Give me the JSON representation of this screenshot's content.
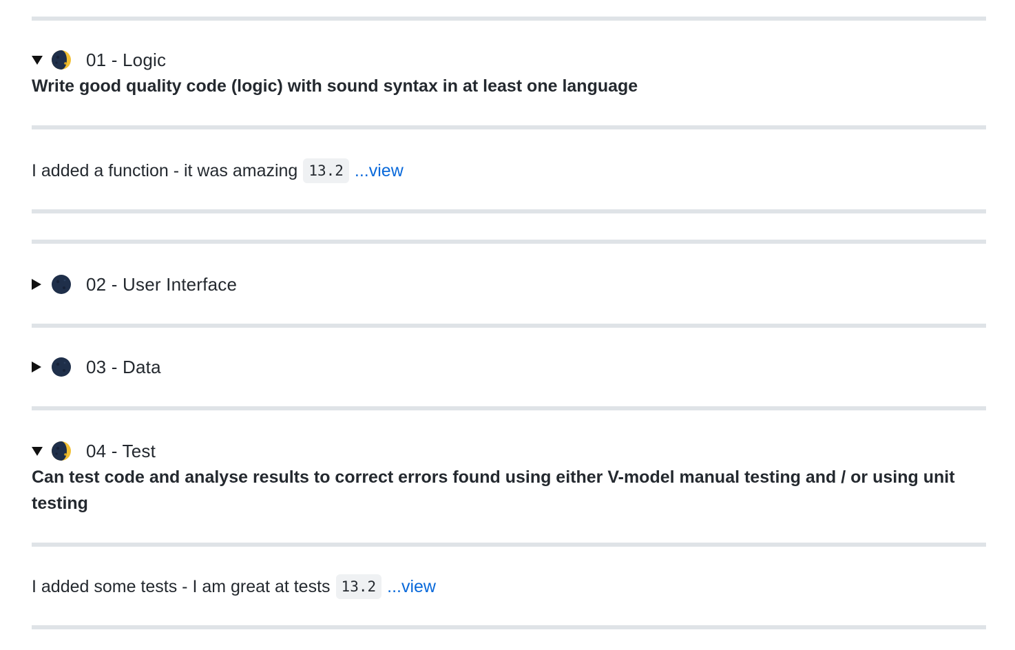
{
  "sections": [
    {
      "summary": "01 - Logic",
      "expanded": true,
      "moon_icon": "first-quarter-moon-icon",
      "description": "Write good quality code (logic) with sound syntax in at least one language",
      "entry_text": "I added a function - it was amazing",
      "entry_version": "13.2",
      "entry_link": "...view"
    },
    {
      "summary": "02 - User Interface",
      "expanded": false,
      "moon_icon": "new-moon-icon"
    },
    {
      "summary": "03 - Data",
      "expanded": false,
      "moon_icon": "new-moon-icon"
    },
    {
      "summary": "04 - Test",
      "expanded": true,
      "moon_icon": "first-quarter-moon-icon",
      "description": "Can test code and analyse results to correct errors found using either V-model manual testing and / or using unit testing",
      "entry_text": "I added some tests - I am great at tests",
      "entry_version": "13.2",
      "entry_link": "...view"
    }
  ],
  "colors": {
    "text": "#24292f",
    "divider": "#dfe3e7",
    "link": "#0969da",
    "code_bg": "#eff1f3",
    "moon_dark": "#1f2f4a",
    "moon_light": "#f5c542"
  }
}
